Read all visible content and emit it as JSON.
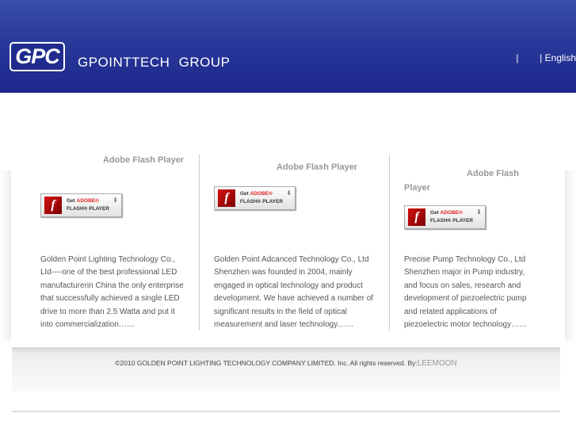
{
  "header": {
    "logo_text": "GPC",
    "brand": "GPOINTTECH GROUP",
    "lang_sep1": "|",
    "lang_sep2": "|",
    "lang_english": "English"
  },
  "columns": [
    {
      "flash_title": "Adobe Flash Player",
      "desc": "Golden Point Lighting Technology Co., Ltd----one of the best professional LED manufacturerin China the only enterprise that successfully achieved a single LED drive to more than 2.5 Watta and put it into commercialization……"
    },
    {
      "flash_title": "Adobe Flash Player",
      "desc": "Golden Point Adcanced Technology Co., Ltd Shenzhen was founded in 2004, mainly engaged in optical technology and product development. We have achieved a number of significant results in the field of optical measurement and laser technology……"
    },
    {
      "flash_title": "Adobe Flash Player",
      "desc": "Precise Pump Technology Co., Ltd Shenzhen major in Pump industry, and focus on sales, research and development of piezoelectric pump and related applications of piezoelectric motor technology……"
    }
  ],
  "flash_button": {
    "get": "Get",
    "adobe": "ADOBE®",
    "flash": "FLASH® PLAYER"
  },
  "footer": {
    "copyright": "©2010 GOLDEN POINT LIGHTING TECHNOLOGY COMPANY LIMITED. Inc. All rights reserved. By:",
    "author": "LEEMOON"
  }
}
